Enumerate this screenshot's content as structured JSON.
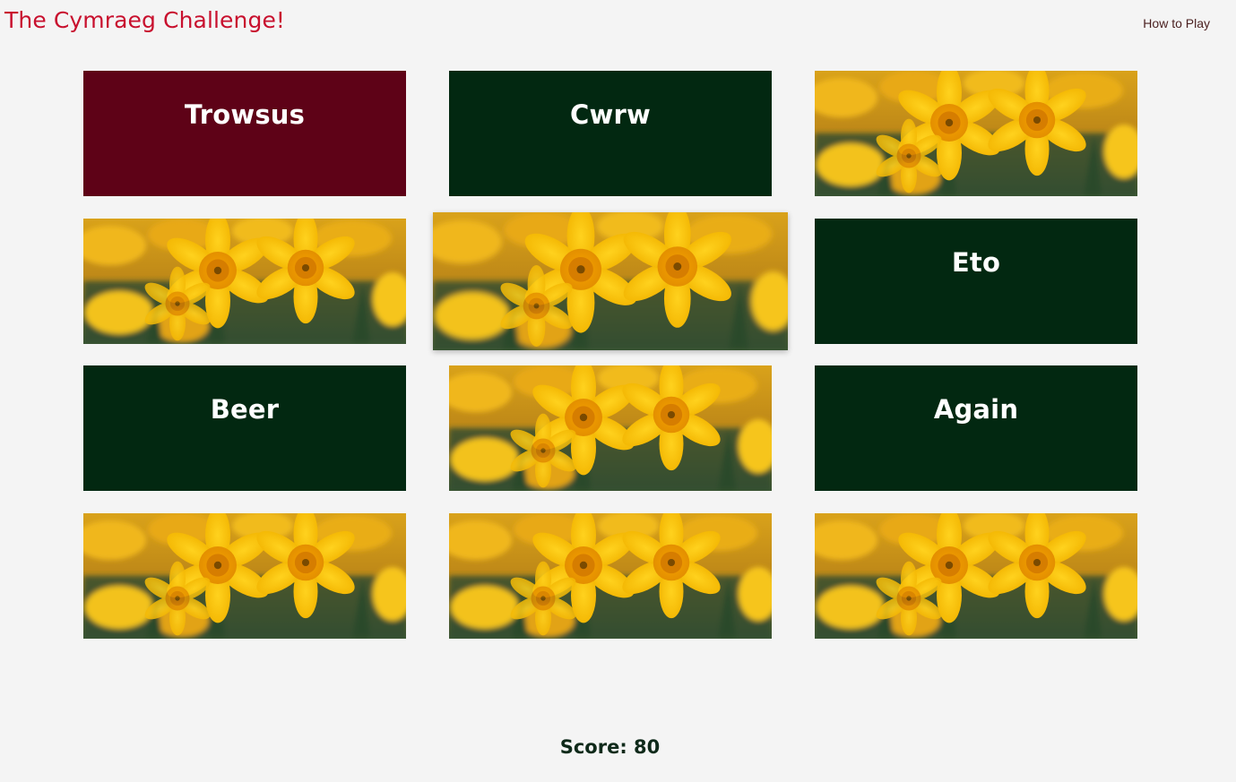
{
  "header": {
    "title": "The Cymraeg Challenge!",
    "how_to_play": "How to Play"
  },
  "colors": {
    "background": "#f4f4f4",
    "title": "#c8102e",
    "selected_card": "#5e0217",
    "word_card": "#022811",
    "score_text": "#0f2a1a"
  },
  "cards": [
    {
      "state": "revealed-selected",
      "text": "Trowsus"
    },
    {
      "state": "revealed",
      "text": "Cwrw"
    },
    {
      "state": "face-down",
      "image": "daffodil-image"
    },
    {
      "state": "face-down",
      "image": "daffodil-image"
    },
    {
      "state": "face-down-hover",
      "image": "daffodil-image"
    },
    {
      "state": "revealed",
      "text": "Eto"
    },
    {
      "state": "revealed",
      "text": "Beer"
    },
    {
      "state": "face-down",
      "image": "daffodil-image"
    },
    {
      "state": "revealed",
      "text": "Again"
    },
    {
      "state": "face-down",
      "image": "daffodil-image"
    },
    {
      "state": "face-down",
      "image": "daffodil-image"
    },
    {
      "state": "face-down",
      "image": "daffodil-image"
    }
  ],
  "score": {
    "label": "Score: 80"
  }
}
